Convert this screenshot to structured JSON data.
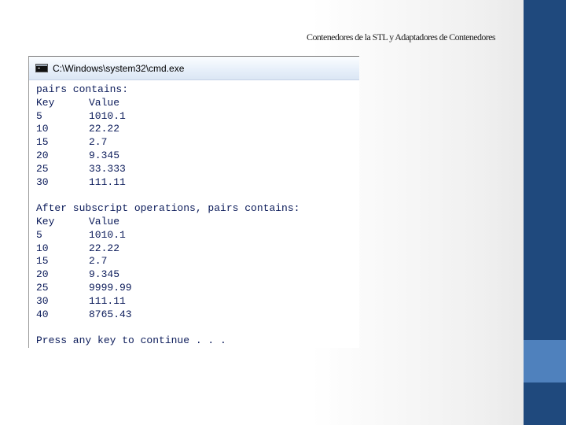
{
  "slide": {
    "title": "Contenedores de la STL y Adaptadores de Contenedores"
  },
  "window": {
    "title": "C:\\Windows\\system32\\cmd.exe",
    "icon": "cmd-icon"
  },
  "console": {
    "section1": {
      "heading": "pairs contains:",
      "header": {
        "key": "Key",
        "value": "Value"
      },
      "rows": [
        {
          "key": "5",
          "value": "1010.1"
        },
        {
          "key": "10",
          "value": "22.22"
        },
        {
          "key": "15",
          "value": "2.7"
        },
        {
          "key": "20",
          "value": "9.345"
        },
        {
          "key": "25",
          "value": "33.333"
        },
        {
          "key": "30",
          "value": "111.11"
        }
      ]
    },
    "section2": {
      "heading": "After subscript operations, pairs contains:",
      "header": {
        "key": "Key",
        "value": "Value"
      },
      "rows": [
        {
          "key": "5",
          "value": "1010.1"
        },
        {
          "key": "10",
          "value": "22.22"
        },
        {
          "key": "15",
          "value": "2.7"
        },
        {
          "key": "20",
          "value": "9.345"
        },
        {
          "key": "25",
          "value": "9999.99"
        },
        {
          "key": "30",
          "value": "111.11"
        },
        {
          "key": "40",
          "value": "8765.43"
        }
      ]
    },
    "prompt": "Press any key to continue . . ."
  },
  "colors": {
    "strip": "#1f497d",
    "strip_accent": "#4f81bd",
    "console_text": "#0b1b5a"
  }
}
